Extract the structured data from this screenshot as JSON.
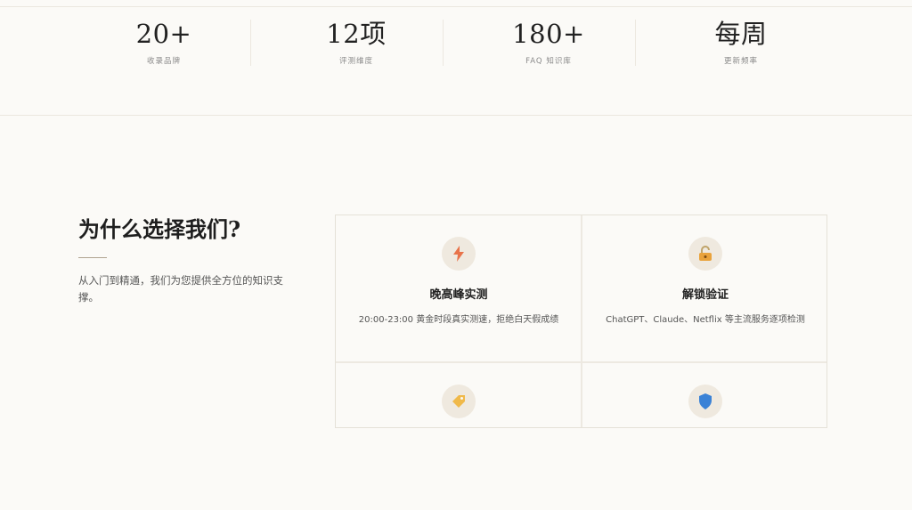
{
  "stats": [
    {
      "value": "20+",
      "label": "收录品牌"
    },
    {
      "value": "12项",
      "label": "评测维度"
    },
    {
      "value": "180+",
      "label": "FAQ 知识库"
    },
    {
      "value": "每周",
      "label": "更新频率"
    }
  ],
  "why": {
    "title": "为什么选择我们?",
    "description": "从入门到精通，我们为您提供全方位的知识支撑。"
  },
  "features": [
    {
      "icon": "lightning-icon",
      "title": "晚高峰实测",
      "desc": "20:00-23:00 黄金时段真实测速，拒绝白天假成绩"
    },
    {
      "icon": "unlock-icon",
      "title": "解锁验证",
      "desc": "ChatGPT、Claude、Netflix 等主流服务逐项检测"
    },
    {
      "icon": "tag-icon",
      "title": "",
      "desc": ""
    },
    {
      "icon": "shield-icon",
      "title": "",
      "desc": ""
    }
  ],
  "colors": {
    "background": "#fbfaf7",
    "accent": "#e8734a",
    "icon_bg": "#efe9df"
  }
}
